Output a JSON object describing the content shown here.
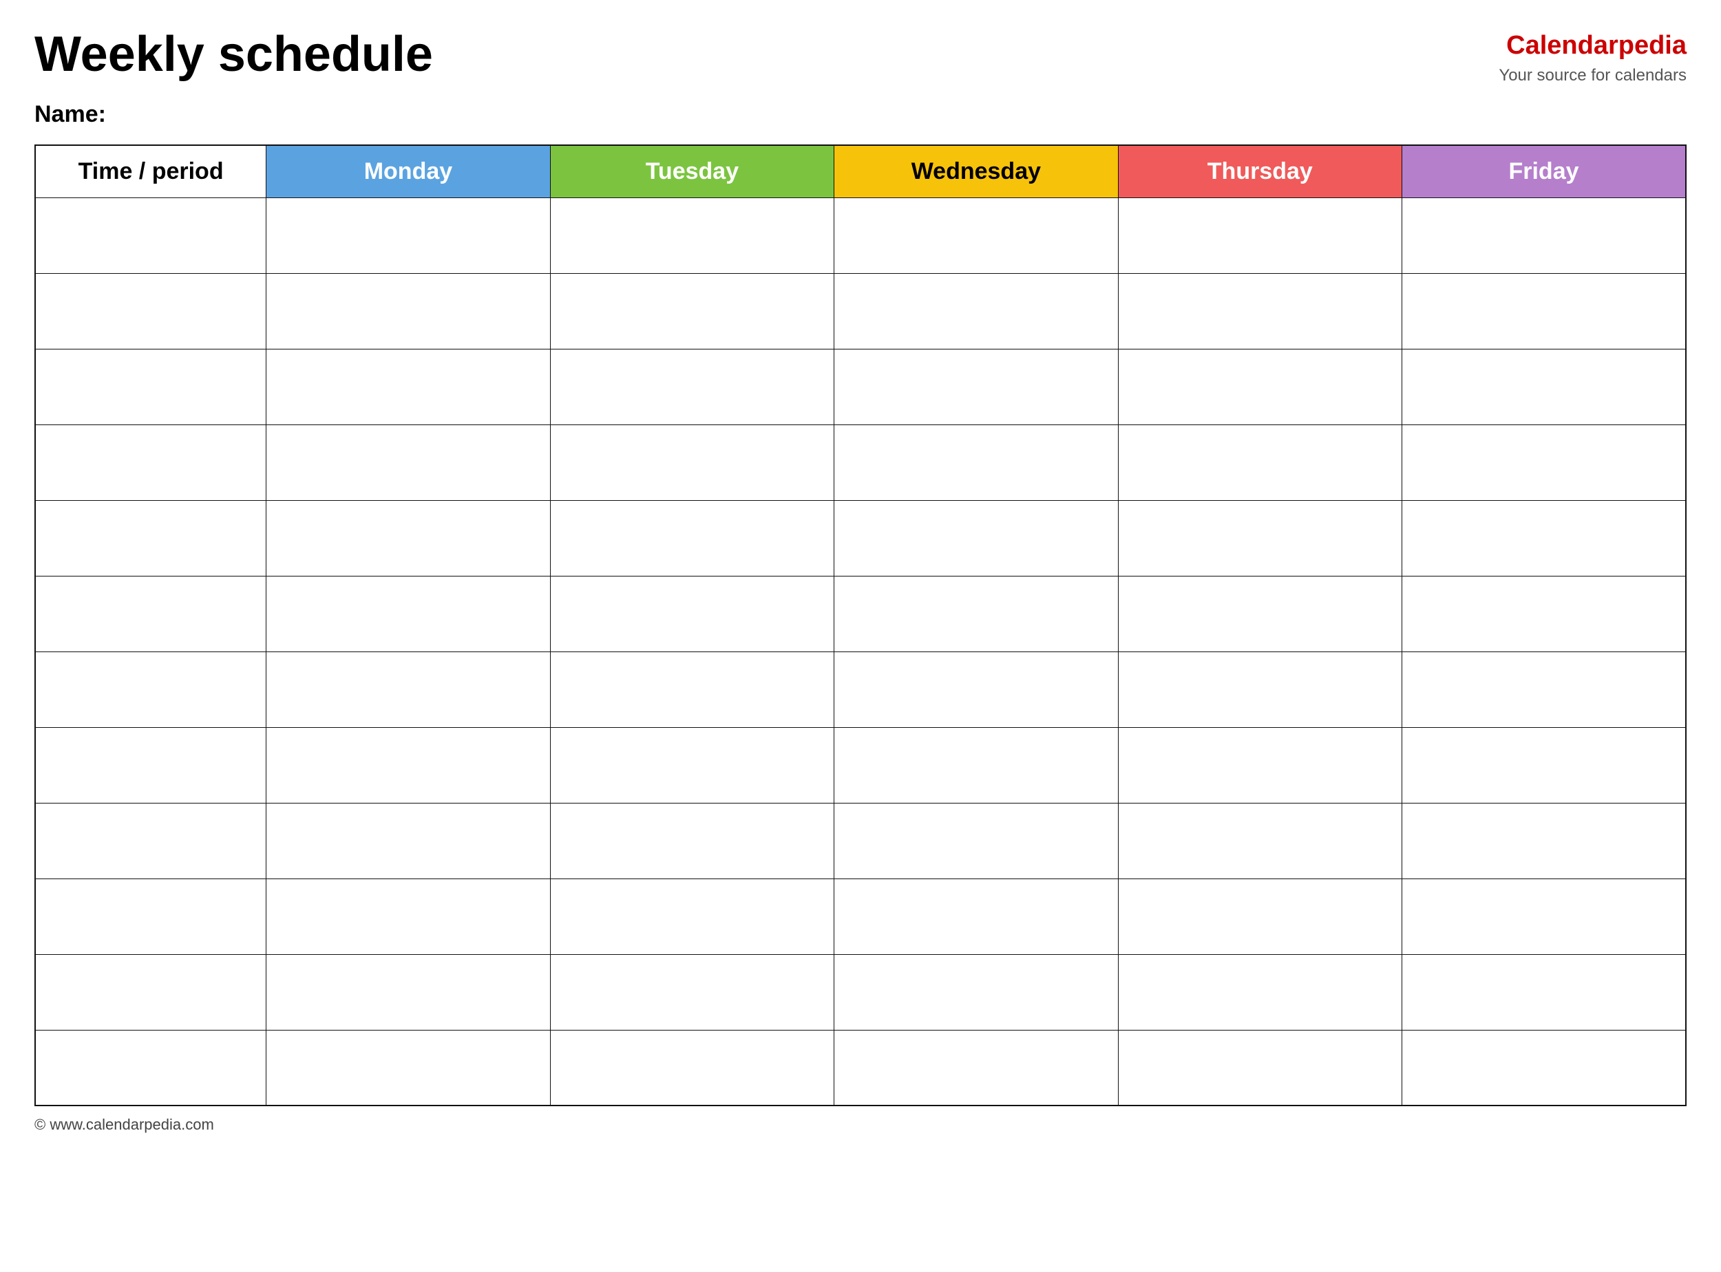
{
  "header": {
    "title": "Weekly schedule",
    "brand_name_part1": "Calendar",
    "brand_name_part2": "pedia",
    "brand_tagline": "Your source for calendars"
  },
  "name_label": "Name:",
  "table": {
    "headers": [
      {
        "id": "time",
        "label": "Time / period",
        "class": "col-time"
      },
      {
        "id": "monday",
        "label": "Monday",
        "class": "col-monday"
      },
      {
        "id": "tuesday",
        "label": "Tuesday",
        "class": "col-tuesday"
      },
      {
        "id": "wednesday",
        "label": "Wednesday",
        "class": "col-wednesday"
      },
      {
        "id": "thursday",
        "label": "Thursday",
        "class": "col-thursday"
      },
      {
        "id": "friday",
        "label": "Friday",
        "class": "col-friday"
      }
    ],
    "row_count": 12
  },
  "footer": {
    "copyright": "© www.calendarpedia.com"
  }
}
